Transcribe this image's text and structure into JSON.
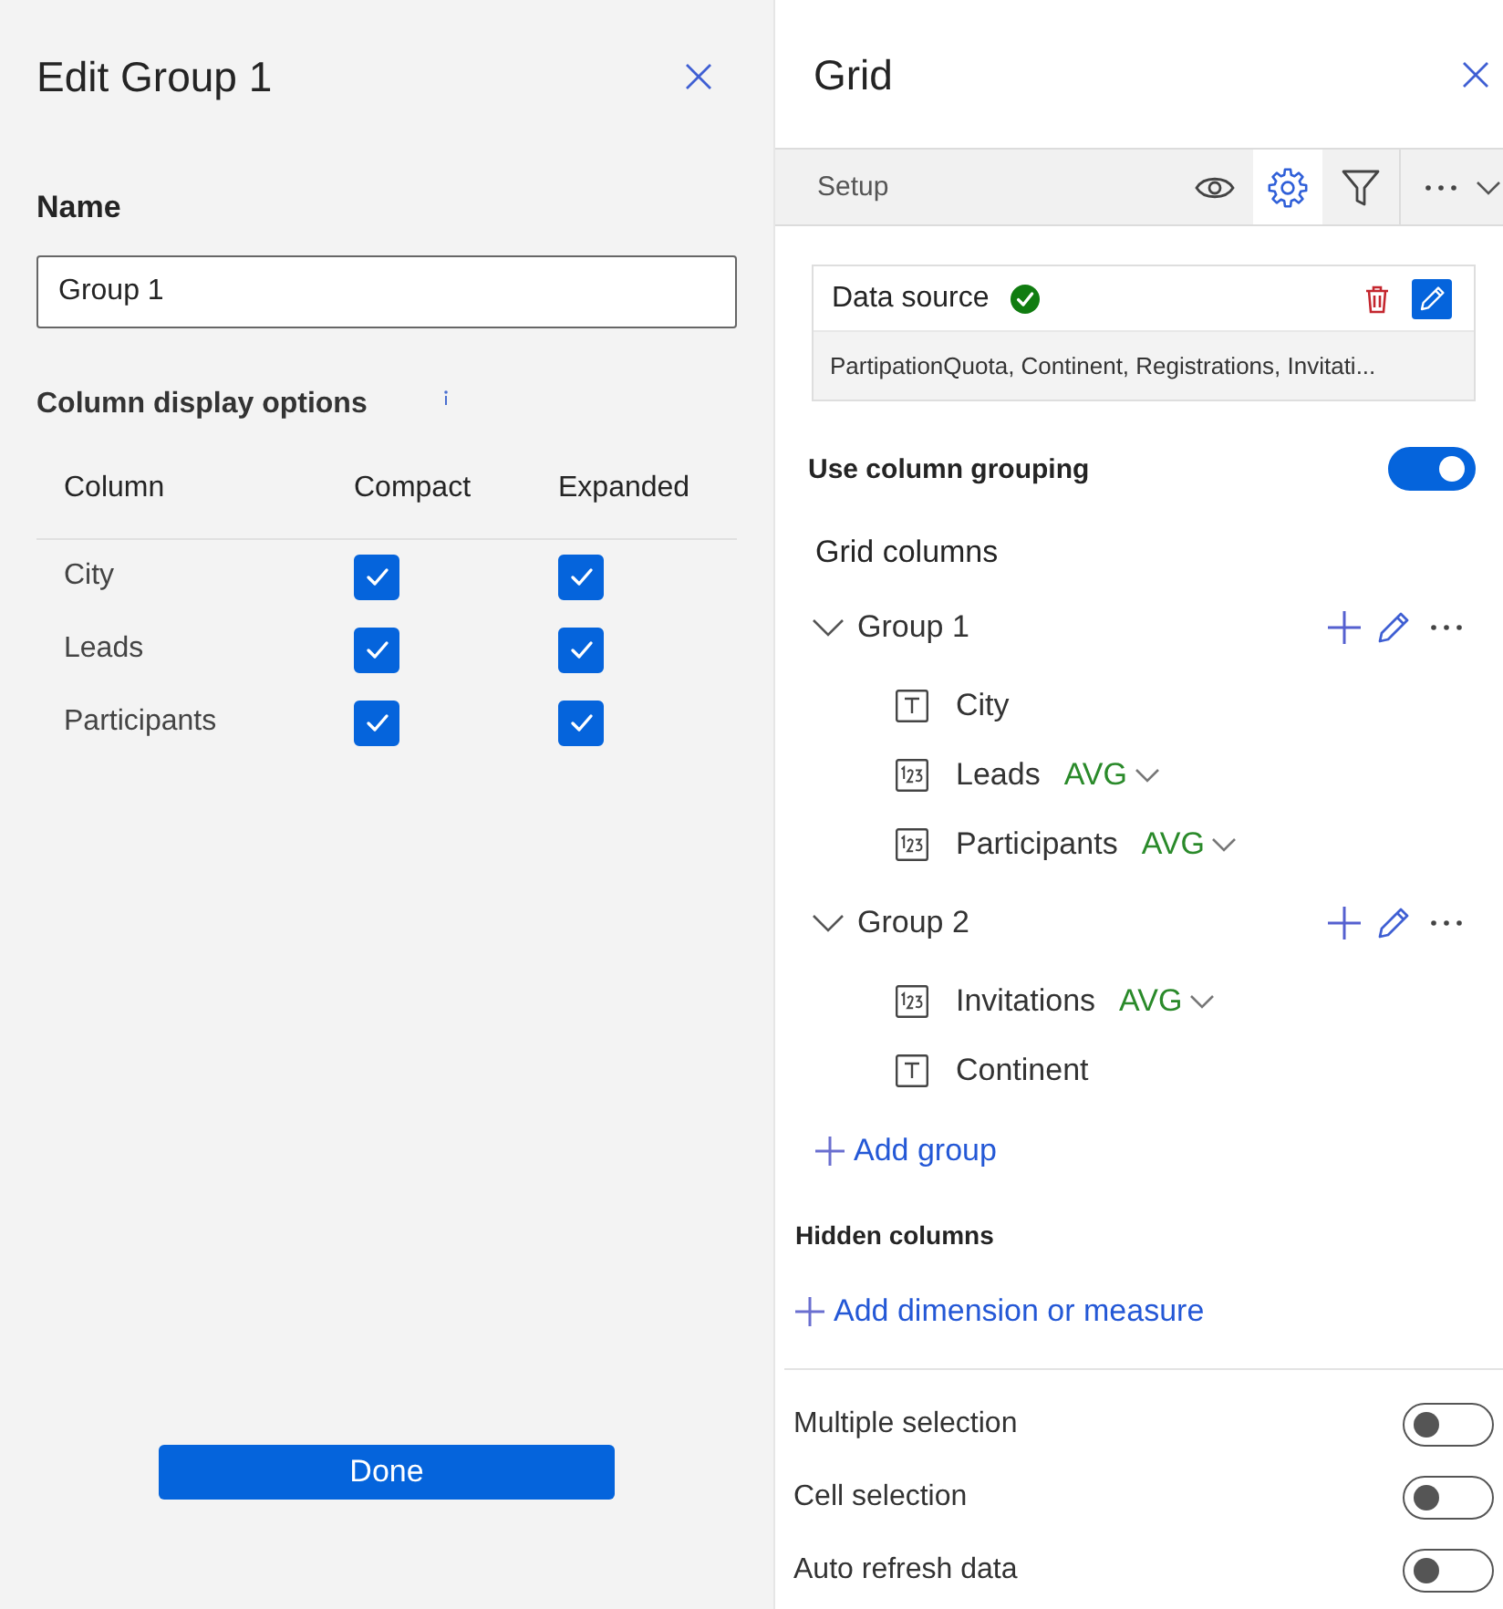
{
  "edit_panel": {
    "title": "Edit Group 1",
    "name_field": {
      "label": "Name",
      "value": "Group 1"
    },
    "options_title": "Column display options",
    "table": {
      "columns": [
        "Column",
        "Compact",
        "Expanded"
      ],
      "rows": [
        {
          "column": "City",
          "compact": true,
          "expanded": true
        },
        {
          "column": "Leads",
          "compact": true,
          "expanded": true
        },
        {
          "column": "Participants",
          "compact": true,
          "expanded": true
        }
      ]
    },
    "done_button": "Done"
  },
  "grid_panel": {
    "title": "Grid",
    "toolbar": {
      "label": "Setup",
      "tools": [
        {
          "kind": "view",
          "selected": false
        },
        {
          "kind": "settings",
          "selected": true
        },
        {
          "kind": "filter",
          "selected": false
        }
      ]
    },
    "data_source": {
      "title": "Data source",
      "valid": true,
      "fields": "PartipationQuota, Continent, Registrations, Invitati..."
    },
    "column_grouping": {
      "label": "Use column grouping",
      "on": true
    },
    "grid_columns": {
      "title": "Grid columns",
      "groups": [
        {
          "label": "Group 1",
          "expanded": true,
          "children": [
            {
              "kind": "text",
              "label": "City"
            },
            {
              "kind": "number",
              "label": "Leads",
              "aggregation": "AVG"
            },
            {
              "kind": "number",
              "label": "Participants",
              "aggregation": "AVG"
            }
          ]
        },
        {
          "label": "Group 2",
          "expanded": true,
          "children": [
            {
              "kind": "number",
              "label": "Invitations",
              "aggregation": "AVG"
            },
            {
              "kind": "text",
              "label": "Continent"
            }
          ]
        }
      ]
    },
    "add_group": "Add group",
    "hidden_columns": {
      "title": "Hidden columns",
      "add_link": "Add dimension or measure"
    },
    "options": [
      {
        "label": "Multiple selection",
        "on": false
      },
      {
        "label": "Cell selection",
        "on": false
      },
      {
        "label": "Auto refresh data",
        "on": false
      }
    ]
  }
}
